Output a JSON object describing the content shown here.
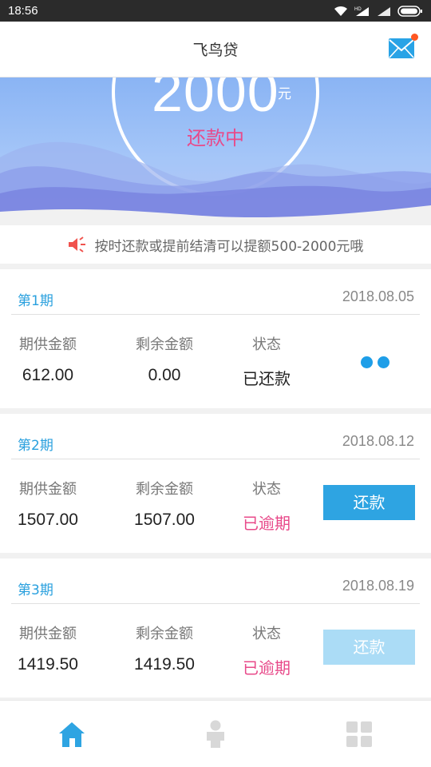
{
  "status_bar": {
    "time": "18:56"
  },
  "header": {
    "title": "飞鸟贷"
  },
  "hero": {
    "amount": "2000",
    "unit": "元",
    "status": "还款中"
  },
  "notice": {
    "text": "按时还款或提前结清可以提额500-2000元哦"
  },
  "columns": {
    "installment": "期供金额",
    "remaining": "剩余金额",
    "status": "状态"
  },
  "installments": [
    {
      "period": "第1期",
      "date": "2018.08.05",
      "installment": "612.00",
      "remaining": "0.00",
      "status": "已还款",
      "action": ""
    },
    {
      "period": "第2期",
      "date": "2018.08.12",
      "installment": "1507.00",
      "remaining": "1507.00",
      "status": "已逾期",
      "action": "还款"
    },
    {
      "period": "第3期",
      "date": "2018.08.19",
      "installment": "1419.50",
      "remaining": "1419.50",
      "status": "已逾期",
      "action": "还款"
    }
  ],
  "colors": {
    "accent": "#2ea4e2",
    "overdue": "#e84a8a",
    "hero": "#8ab4f4"
  },
  "icons": {
    "mail": "mail-icon",
    "speaker": "speaker-icon",
    "home": "home-icon",
    "user": "user-icon",
    "apps": "grid-icon"
  }
}
